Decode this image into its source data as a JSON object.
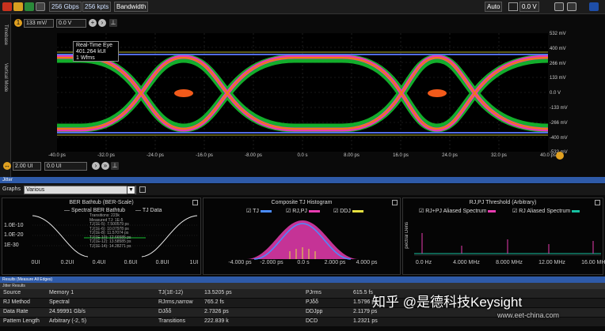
{
  "toolbar": {
    "acq1": "256 Gbps",
    "acq2": "256 kpts",
    "bandwidth": "Bandwidth",
    "trigger_mode": "Auto",
    "trigger_level": "0.0 V"
  },
  "side_tabs": [
    "Timebase",
    "Vertical Mode"
  ],
  "plot_controls": {
    "scale": "133 mV/",
    "offset": "0.0 V",
    "time_scale": "2.00 UI",
    "time_offset": "0.0 UI"
  },
  "eye_info": {
    "title": "Real-Time Eye",
    "rate": "401.264 kUI",
    "wfms": "1 Wfms"
  },
  "y_labels": [
    "532 mV",
    "400 mV",
    "266 mV",
    "133 mV",
    "0.0 V",
    "-133 mV",
    "-266 mV",
    "-400 mV",
    "-532 mV"
  ],
  "x_labels": [
    "-40.0 ps",
    "-32.0 ps",
    "-24.0 ps",
    "-16.0 ps",
    "-8.00 ps",
    "0.0 s",
    "8.00 ps",
    "16.0 ps",
    "24.0 ps",
    "32.0 ps",
    "40.0 ps"
  ],
  "graphs_bar": {
    "title": "Jitter",
    "label": "Graphs",
    "select": "Various"
  },
  "bathtub": {
    "title": "BER Bathtub (BER-Scale)",
    "legend": [
      "Spectral BER Bathtub",
      "TJ Data"
    ],
    "y_ticks": [
      "1.0E-10",
      "1.0E-20",
      "1E-30"
    ],
    "x_ticks": [
      "0UI",
      "0.2UI",
      "0.4UI",
      "0.6UI",
      "0.8UI",
      "1UI"
    ],
    "annotations": [
      "Transitions: 223k",
      "Measured TJ: 1E-5",
      "TJ(1E-5): 7.500579 ps",
      "TJ(1E-6): 10.07978 ps",
      "TJ(1E-8): 11.57074 ps",
      "TJ(1E-10): 12.66585 ps",
      "TJ(1E-12): 13.58585 ps",
      "TJ(1E-14): 14.28271 ps"
    ]
  },
  "histogram": {
    "title": "Composite TJ Histogram",
    "legend": [
      "TJ",
      "RJ,PJ",
      "DDJ"
    ],
    "x_ticks": [
      "-4.000 ps",
      "-2.000 ps",
      "0.0 s",
      "2.000 ps",
      "4.000 ps"
    ]
  },
  "spectrum": {
    "title": "RJ,PJ Threshold (Arbitrary)",
    "legend": [
      "RJ+PJ Aliased Spectrum",
      "RJ Aliased Spectrum"
    ],
    "y_label": "pectral Dens",
    "x_ticks": [
      "0.0 Hz",
      "4.000 MHz",
      "8.000 MHz",
      "12.00 MHz",
      "16.00 MHz"
    ]
  },
  "results": {
    "header": "Results (Measure All Edges)",
    "subheader": "Jitter Results",
    "rows": [
      [
        "Source",
        "Memory 1",
        "TJ(1E-12)",
        "13.5205 ps",
        "PJrms",
        "615.5 fs"
      ],
      [
        "RJ Method",
        "Spectral",
        "RJrms,narrow",
        "765.2 fs",
        "PJδδ",
        "1.5796 ps"
      ],
      [
        "Data Rate",
        "24.99991 Gb/s",
        "DJδδ",
        "2.7326 ps",
        "DDJpp",
        "2.1179 ps"
      ],
      [
        "Pattern Length",
        "Arbitrary (-2, 5)",
        "Transitions",
        "222.839 k",
        "DCD",
        "1.2321 ps"
      ]
    ]
  },
  "watermark": "知乎 @是德科技Keysight",
  "watermark2": "www.eet-china.com",
  "colors": {
    "eye_green": "#16c030",
    "eye_pink": "#e83cb0",
    "eye_orange": "#f07a14",
    "eye_blue": "#5a78ff",
    "accent": "#2e5aa8"
  }
}
